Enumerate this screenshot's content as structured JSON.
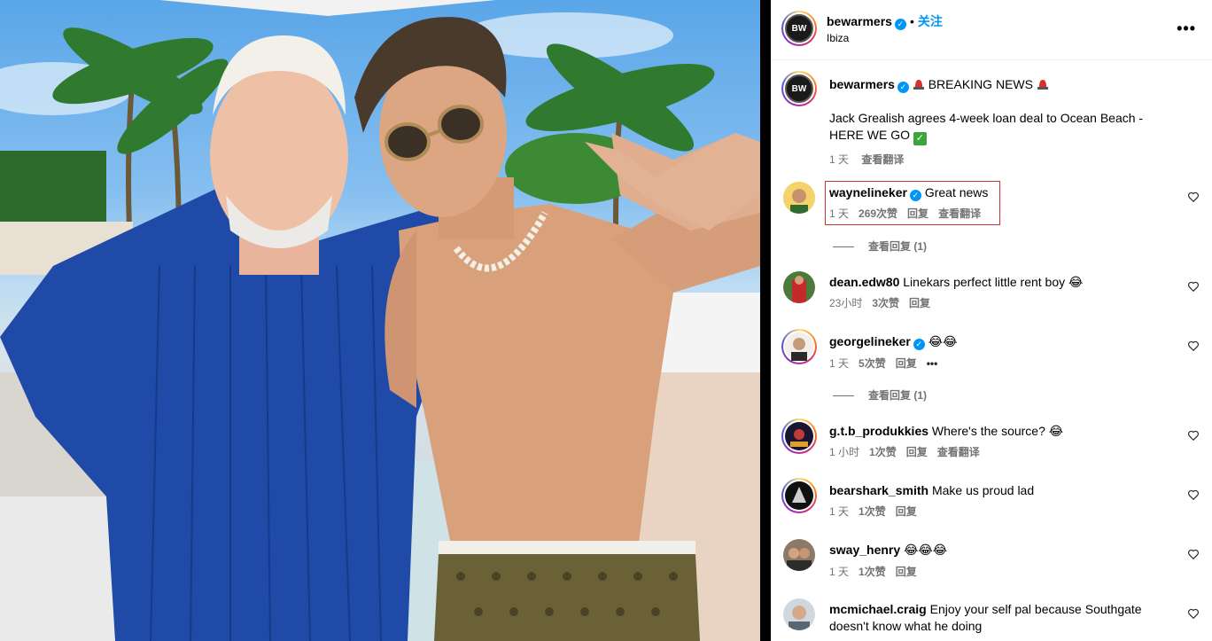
{
  "header": {
    "username": "bewarmers",
    "follow_label": "关注",
    "location": "Ibiza",
    "avatar_text": "BW"
  },
  "caption": {
    "username": "bewarmers",
    "headline": "BREAKING NEWS",
    "body": "Jack Grealish agrees 4-week loan deal to Ocean Beach - HERE WE GO",
    "time": "1 天",
    "translate": "查看翻译"
  },
  "comments": [
    {
      "username": "waynelineker",
      "verified": true,
      "text": "Great news",
      "time": "1 天",
      "likes": "269次赞",
      "reply": "回复",
      "translate": "查看翻译",
      "view_replies": "查看回复 (1)"
    },
    {
      "username": "dean.edw80",
      "verified": false,
      "text": "Linekars perfect little rent boy 😂",
      "time": "23小时",
      "likes": "3次赞",
      "reply": "回复"
    },
    {
      "username": "georgelineker",
      "verified": true,
      "text": "😂😂",
      "time": "1 天",
      "likes": "5次赞",
      "reply": "回复",
      "more": "•••",
      "view_replies": "查看回复 (1)"
    },
    {
      "username": "g.t.b_produkkies",
      "verified": false,
      "text": "Where's the source? 😂",
      "time": "1 小时",
      "likes": "1次赞",
      "reply": "回复",
      "translate": "查看翻译"
    },
    {
      "username": "bearshark_smith",
      "verified": false,
      "text": "Make us proud lad",
      "time": "1 天",
      "likes": "1次赞",
      "reply": "回复"
    },
    {
      "username": "sway_henry",
      "verified": false,
      "text": "😂😂😂",
      "time": "1 天",
      "likes": "1次赞",
      "reply": "回复"
    },
    {
      "username": "mcmichael.craig",
      "verified": false,
      "text": "Enjoy your self pal because Southgate doesn't know what he doing"
    }
  ],
  "colors": {
    "accent": "#0095f6",
    "highlight": "#c8352f",
    "muted": "#737373"
  }
}
